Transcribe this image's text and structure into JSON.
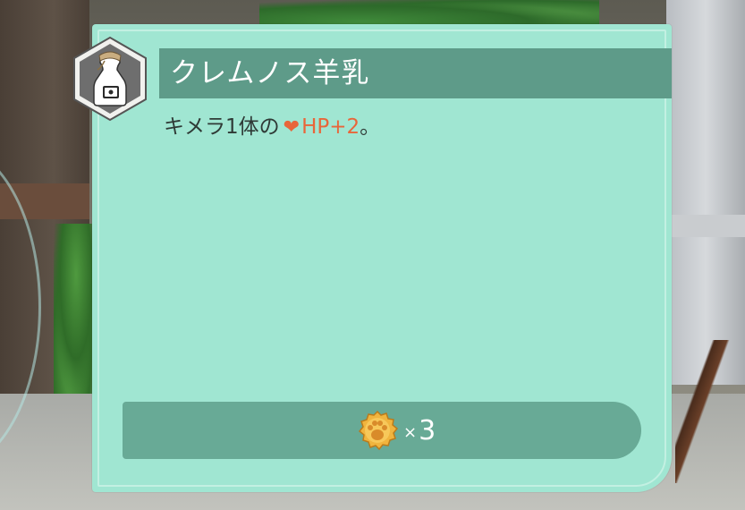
{
  "item": {
    "name": "クレムノス羊乳",
    "icon": "milk-bottle-icon",
    "description_prefix": "キメラ1体の",
    "effect_icon": "heart-icon",
    "effect_text": "HP+2",
    "description_suffix": "。"
  },
  "cost": {
    "icon": "paw-coin-icon",
    "multiplier": "×",
    "amount": "3"
  },
  "colors": {
    "card_bg": "#a0e6d2",
    "title_bar": "#5e9b89",
    "cost_bar": "#68aa96",
    "effect": "#e8663a"
  }
}
